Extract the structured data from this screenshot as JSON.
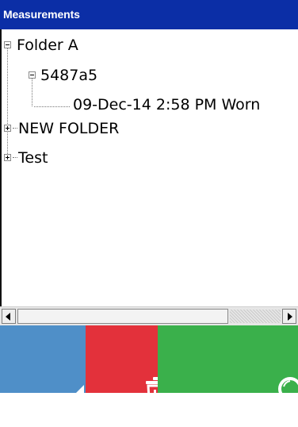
{
  "titlebar": {
    "title": "Measurements"
  },
  "tree": {
    "nodes": [
      {
        "label": "Folder A",
        "level": 0,
        "expanded": true
      },
      {
        "label": "5487a5",
        "level": 1,
        "expanded": true
      },
      {
        "label": "09-Dec-14 2:58 PM Worn",
        "level": 2
      },
      {
        "label": "NEW FOLDER",
        "level": 0,
        "expanded": false
      },
      {
        "label": "Test",
        "level": 0,
        "expanded": false
      }
    ]
  },
  "scrollbar": {
    "scroll_position": 0
  },
  "toolbar": {
    "buttons": [
      {
        "name": "back",
        "icon": "back-arrow-icon",
        "color": "#4f8fc8"
      },
      {
        "name": "delete",
        "icon": "trash-icon",
        "color": "#e3313b"
      },
      {
        "name": "search",
        "icon": "magnifier-icon",
        "color": "#3ab04b"
      }
    ]
  }
}
